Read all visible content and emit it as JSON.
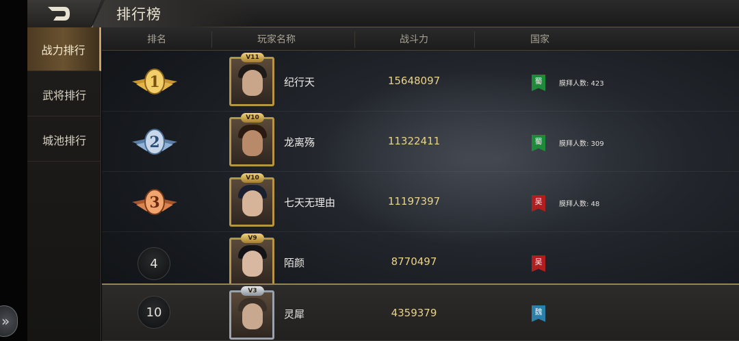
{
  "colors": {
    "accent_gold": "#c9a45a",
    "power_text": "#ead48a",
    "shu": "#1f8a3a",
    "wu": "#b01f1f",
    "wei": "#2c7fa8"
  },
  "header": {
    "title": "排行榜",
    "back_icon": "back-arrow-icon"
  },
  "side_handle": {
    "icon": "double-chevron-right-icon",
    "glyph": "»"
  },
  "sidebar": {
    "tabs": [
      {
        "label": "战力排行",
        "active": true
      },
      {
        "label": "武将排行",
        "active": false
      },
      {
        "label": "城池排行",
        "active": false
      }
    ]
  },
  "table": {
    "columns": [
      "排名",
      "玩家名称",
      "战斗力",
      "国家"
    ],
    "rows": [
      {
        "rank": "1",
        "medal": "gold",
        "vip": "V11",
        "name": "纪行天",
        "power": "15648097",
        "nation": "蜀",
        "worship": "膜拜人数: 423"
      },
      {
        "rank": "2",
        "medal": "silver",
        "vip": "V10",
        "name": "龙离殇",
        "power": "11322411",
        "nation": "蜀",
        "worship": "膜拜人数: 309"
      },
      {
        "rank": "3",
        "medal": "bronze",
        "vip": "V10",
        "name": "七天无理由",
        "power": "11197397",
        "nation": "吴",
        "worship": "膜拜人数: 48"
      },
      {
        "rank": "4",
        "medal": "none",
        "vip": "V9",
        "name": "陌颜",
        "power": "8770497",
        "nation": "吴",
        "worship": ""
      }
    ],
    "my_row": {
      "rank": "10",
      "vip": "V3",
      "name": "灵犀",
      "power": "4359379",
      "nation": "魏"
    }
  }
}
